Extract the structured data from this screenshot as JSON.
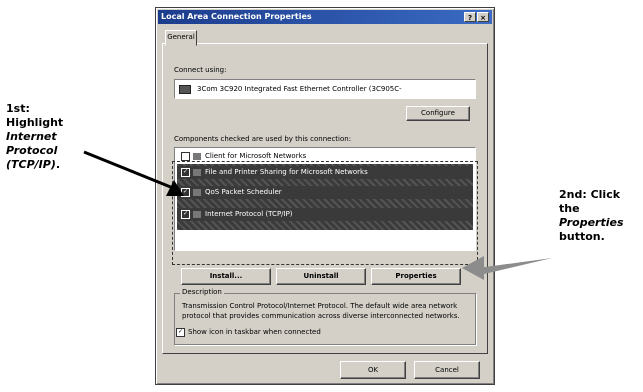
{
  "callouts": {
    "left_prefix": "1st: Highlight",
    "left_emphasis": "Internet Protocol (TCP/IP)",
    "left_suffix": ".",
    "right_prefix": "2nd: Click the",
    "right_emphasis": "Properties",
    "right_suffix": "button."
  },
  "dialog": {
    "title": "Local Area Connection Properties",
    "help_label": "?",
    "close_label": "×",
    "tab_general": "General",
    "connect_using_label": "Connect using:",
    "adapter_name": "3Com 3C920 Integrated Fast Ethernet Controller (3C905C-",
    "configure_label": "Configure",
    "components_label": "Components checked are used by this connection:",
    "components": [
      {
        "label": "Client for Microsoft Networks",
        "checked": false,
        "selected": false
      },
      {
        "label": "File and Printer Sharing for Microsoft Networks",
        "checked": true,
        "selected": true
      },
      {
        "label": "QoS Packet Scheduler",
        "checked": true,
        "selected": true
      },
      {
        "label": "Internet Protocol (TCP/IP)",
        "checked": true,
        "selected": true
      }
    ],
    "install_label": "Install...",
    "uninstall_label": "Uninstall",
    "properties_label": "Properties",
    "description_title": "Description",
    "description_text": "Transmission Control Protocol/Internet Protocol. The default wide area network protocol that provides communication across diverse interconnected networks.",
    "show_icon_label": "Show icon in taskbar when connected",
    "show_icon_checked": true,
    "ok_label": "OK",
    "cancel_label": "Cancel"
  },
  "colors": {
    "titlebar": "#1c3c8c",
    "dialog_face": "#d4d0c8",
    "selection": "#3b3b3b",
    "arrow": "#8c8c8c"
  }
}
